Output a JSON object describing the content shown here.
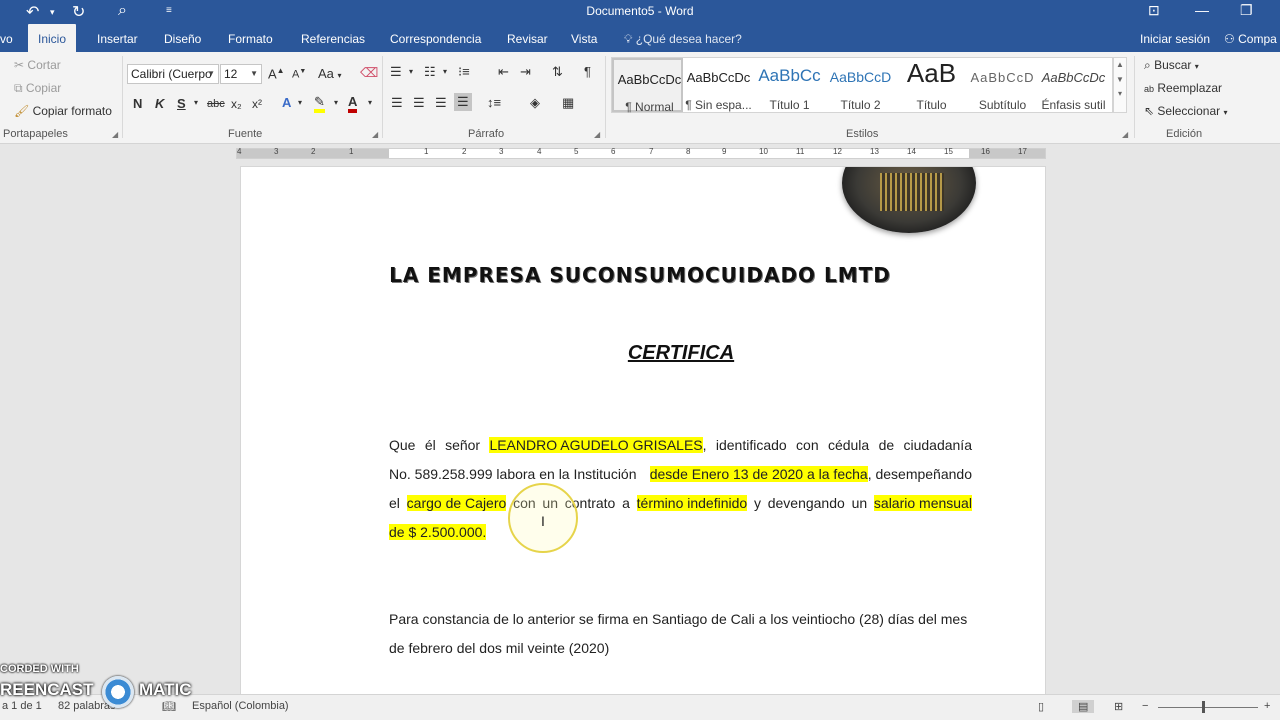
{
  "window": {
    "title": "Documento5 - Word"
  },
  "tabs": [
    {
      "label": "vo"
    },
    {
      "label": "Inicio"
    },
    {
      "label": "Insertar"
    },
    {
      "label": "Diseño"
    },
    {
      "label": "Formato"
    },
    {
      "label": "Referencias"
    },
    {
      "label": "Correspondencia"
    },
    {
      "label": "Revisar"
    },
    {
      "label": "Vista"
    }
  ],
  "tell_me": "¿Qué desea hacer?",
  "sign_in": "Iniciar sesión",
  "share": "Compa",
  "clipboard": {
    "cut": "Cortar",
    "copy": "Copiar",
    "format_painter": "Copiar formato",
    "label": "Portapapeles"
  },
  "font": {
    "family": "Calibri (Cuerpo",
    "size": "12",
    "label": "Fuente",
    "bold": "N",
    "italic": "K",
    "underline": "S",
    "strike": "abc",
    "subscript": "x₂",
    "superscript": "x²",
    "case": "Aa",
    "grow": "A",
    "shrink": "A"
  },
  "paragraph": {
    "label": "Párrafo"
  },
  "styles": {
    "label": "Estilos",
    "items": [
      {
        "preview": "AaBbCcDc",
        "name": "¶ Normal"
      },
      {
        "preview": "AaBbCcDc",
        "name": "¶ Sin espa..."
      },
      {
        "preview": "AaBbCc",
        "name": "Título 1"
      },
      {
        "preview": "AaBbCcD",
        "name": "Título 2"
      },
      {
        "preview": "AaB",
        "name": "Título"
      },
      {
        "preview": "AaBbCcD",
        "name": "Subtítulo"
      },
      {
        "preview": "AaBbCcDc",
        "name": "Énfasis sutil"
      }
    ]
  },
  "editing": {
    "label": "Edición",
    "find": "Buscar",
    "replace": "Reemplazar",
    "select": "Seleccionar"
  },
  "ruler": {
    "numbers": [
      "4",
      "3",
      "2",
      "1",
      "1",
      "2",
      "3",
      "4",
      "5",
      "6",
      "7",
      "8",
      "9",
      "10",
      "11",
      "12",
      "13",
      "14",
      "15",
      "16",
      "17"
    ]
  },
  "document": {
    "company": "LA EMPRESA SUCONSUMOCUIDADO LMTD",
    "heading": "CERTIFICA",
    "p1": {
      "l1a": "Que",
      "l1b": "él",
      "l1c": "señor",
      "l1d": "LEANDRO AGUDELO GRISALES",
      "l1e": ",",
      "l1f": "identificado",
      "l1g": "con",
      "l1h": "cédula",
      "l1i": "de",
      "l1j": "ciudadanía",
      "l2a": "No. 589.258.999 labora en la Institución",
      "l2b": "desde Enero 13 de 2020 a la fecha",
      "l2c": ", desempeñando",
      "l3a": "el",
      "l3b": "cargo de Cajero",
      "l3c": "con",
      "l3d": "un",
      "l3e": "contrato",
      "l3f": "a",
      "l3g": "término indefinido",
      "l3h": "y",
      "l3i": "devengando",
      "l3j": "un",
      "l3k": "salario mensual",
      "l4a": "de $ 2.500.000."
    },
    "p2": {
      "l1": "Para constancia de lo anterior se firma en Santiago de Cali a los veintiocho (28) días del mes",
      "l2": "de febrero del dos mil veinte (2020)"
    }
  },
  "status": {
    "page": "a 1 de 1",
    "words": "82 palabras",
    "language": "Español (Colombia)"
  },
  "watermark": {
    "line1": "CORDED WITH",
    "line2a": "REENCAST",
    "line2b": "MATIC"
  }
}
